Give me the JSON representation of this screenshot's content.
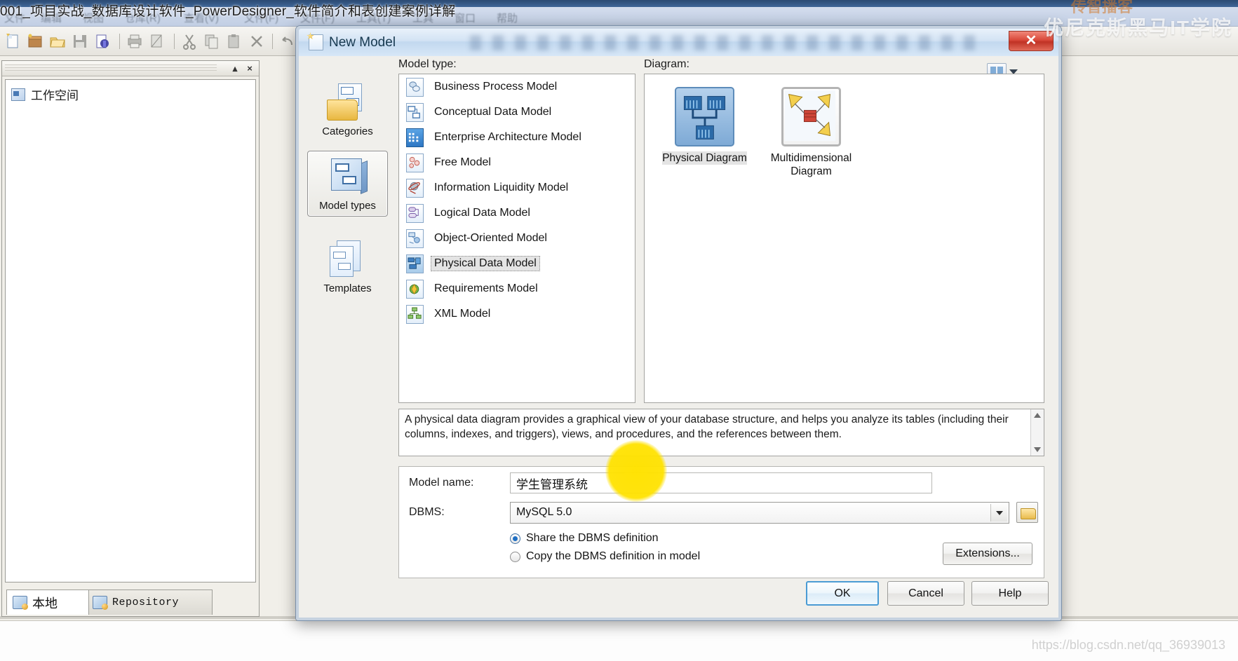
{
  "window": {
    "overlay_title": "001_项目实战_数据库设计软件_PowerDesigner_软件简介和表创建案例详解",
    "app_title": "PowerDesigner",
    "menus": [
      {
        "label": "文件"
      },
      {
        "label": "编辑"
      },
      {
        "label": "视图"
      },
      {
        "label": "仓库(R)"
      },
      {
        "label": "查看(V)"
      },
      {
        "label": "文件(F)"
      },
      {
        "label": "文件(F)"
      },
      {
        "label": "工具(T)"
      },
      {
        "label": "工具"
      },
      {
        "label": "窗口"
      },
      {
        "label": "帮助"
      }
    ],
    "toolbar_icons": [
      "new-model-icon",
      "new-package-icon",
      "open-icon",
      "save-icon",
      "print-icon",
      "print-preview-icon",
      "properties-icon",
      "cut-icon",
      "copy-icon",
      "paste-icon",
      "delete-icon",
      "undo-icon"
    ]
  },
  "workspace": {
    "title_node": "工作空间",
    "close_label": "×",
    "minimize_label": "▴",
    "tabs": [
      {
        "label": "本地",
        "icon": "local-workspace-icon",
        "active": true
      },
      {
        "label": "Repository",
        "icon": "repository-icon",
        "active": false
      }
    ]
  },
  "watermarks": {
    "top_right": "优尼克斯黑马IT学院",
    "top_right_partial": "传智播客",
    "bottom_right": "https://blog.csdn.net/qq_36939013"
  },
  "dialog": {
    "title": "New Model",
    "close_label": "✕",
    "view_switch_icon": "list-view-icon",
    "view_switch_caret": "chevron-down-icon",
    "rail": [
      {
        "label": "Categories",
        "icon": "categories-icon",
        "selected": false
      },
      {
        "label": "Model types",
        "icon": "model-types-icon",
        "selected": true
      },
      {
        "label": "Templates",
        "icon": "templates-icon",
        "selected": false
      }
    ],
    "model_type_label": "Model type:",
    "model_types": [
      {
        "label": "Business Process Model",
        "icon": "business-process-model-icon",
        "selected": false
      },
      {
        "label": "Conceptual Data Model",
        "icon": "conceptual-data-model-icon",
        "selected": false
      },
      {
        "label": "Enterprise Architecture Model",
        "icon": "enterprise-architecture-model-icon",
        "selected": false
      },
      {
        "label": "Free Model",
        "icon": "free-model-icon",
        "selected": false
      },
      {
        "label": "Information Liquidity Model",
        "icon": "information-liquidity-model-icon",
        "selected": false
      },
      {
        "label": "Logical Data Model",
        "icon": "logical-data-model-icon",
        "selected": false
      },
      {
        "label": "Object-Oriented Model",
        "icon": "object-oriented-model-icon",
        "selected": false
      },
      {
        "label": "Physical Data Model",
        "icon": "physical-data-model-icon",
        "selected": true
      },
      {
        "label": "Requirements Model",
        "icon": "requirements-model-icon",
        "selected": false
      },
      {
        "label": "XML Model",
        "icon": "xml-model-icon",
        "selected": false
      }
    ],
    "diagram_label": "Diagram:",
    "diagrams": [
      {
        "label": "Physical Diagram",
        "icon": "physical-diagram-icon",
        "selected": true
      },
      {
        "label": "Multidimensional Diagram",
        "icon": "multidimensional-diagram-icon",
        "selected": false
      }
    ],
    "description": "A physical data diagram provides a graphical view of your database structure, and helps you analyze its tables (including their columns, indexes, and triggers), views, and procedures, and the references between them.",
    "form": {
      "model_name_label": "Model name:",
      "model_name_value": "学生管理系统",
      "dbms_label": "DBMS:",
      "dbms_value": "MySQL 5.0",
      "dbms_browse_icon": "folder-open-icon",
      "radio_share": "Share the DBMS definition",
      "radio_copy": "Copy the DBMS definition in model",
      "radio_selected": "share",
      "extensions_button": "Extensions..."
    },
    "buttons": {
      "ok": "OK",
      "cancel": "Cancel",
      "help": "Help"
    }
  }
}
